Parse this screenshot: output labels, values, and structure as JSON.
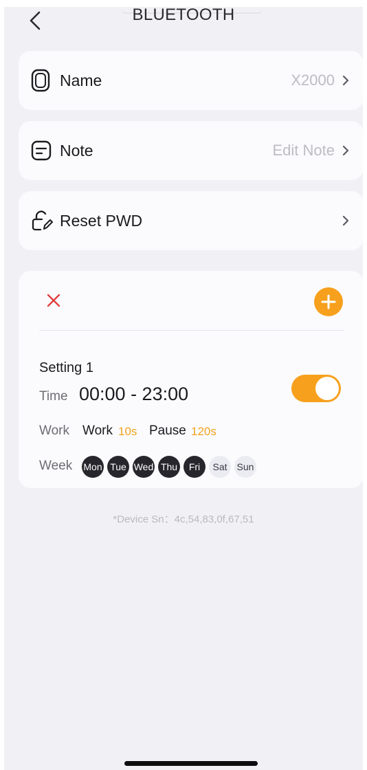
{
  "header": {
    "title": "BLUETOOTH",
    "back_icon": "chevron-left-icon"
  },
  "settings": [
    {
      "icon": "watch-icon",
      "label": "Name",
      "value": "X2000"
    },
    {
      "icon": "note-icon",
      "label": "Note",
      "value": "Edit Note"
    },
    {
      "icon": "lock-edit-icon",
      "label": "Reset PWD",
      "value": ""
    }
  ],
  "schedule": {
    "delete_icon": "close-icon",
    "add_icon": "plus-icon",
    "name": "Setting 1",
    "time_label": "Time",
    "time_value": "00:00 - 23:00",
    "enabled": true,
    "work_label": "Work",
    "work_text": "Work",
    "work_value": "10s",
    "pause_text": "Pause",
    "pause_value": "120s",
    "week_label": "Week",
    "days": [
      {
        "label": "Mon",
        "active": true
      },
      {
        "label": "Tue",
        "active": true
      },
      {
        "label": "Wed",
        "active": true
      },
      {
        "label": "Thu",
        "active": true
      },
      {
        "label": "Fri",
        "active": true
      },
      {
        "label": "Sat",
        "active": false
      },
      {
        "label": "Sun",
        "active": false
      }
    ]
  },
  "footer": {
    "device_sn": "*Device Sn：4c,54,83,0f,67,51"
  },
  "colors": {
    "accent": "#f7a01d",
    "delete": "#e0403f",
    "day_active": "#26262c",
    "background": "#f1f1f5"
  }
}
